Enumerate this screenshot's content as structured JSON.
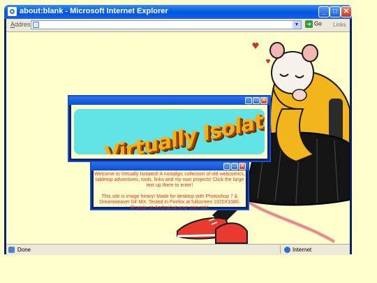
{
  "browser": {
    "title": "about:blank - Microsoft Internet Explorer",
    "address_label": "Address",
    "go_label": "Go",
    "links_label": "Links",
    "status_text": "Done",
    "zone_text": "Internet"
  },
  "banner": {
    "logo_text": "Virtually Isolated"
  },
  "welcome": {
    "line1": "Welcome to Virtually Isolated! A nostalgic collection of old webcomics, tabletop adventures, tools, links and my own projects! Click the large text up there to enter!",
    "line2": "This site is image heavy! Made for desktop with Photoshop 7 & Dreamweaver 04' MX. Tested in Firefox at fullscreen 1920X1080. Browse on Android at your own risk!"
  },
  "colors": {
    "page_bg": "#fffecd",
    "xp_blue": "#0054e3",
    "banner_cyan": "#62e4e4",
    "logo_orange": "#f4b01d",
    "welcome_red": "#e0301f",
    "hoodie_yellow": "#f3b51c"
  }
}
